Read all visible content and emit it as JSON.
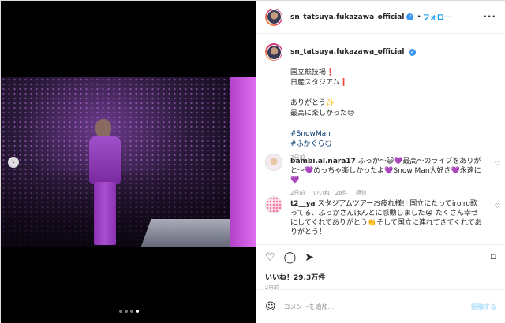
{
  "header": {
    "username": "sn_tatsuya.fukazawa_official",
    "separator": "•",
    "follow_label": "フォロー",
    "more_label": "···"
  },
  "media": {
    "prev_label": "‹",
    "dots": 4,
    "active_dot": 4
  },
  "caption": {
    "username": "sn_tatsuya.fukazawa_official",
    "lines": [
      "国立競技場❗",
      "日産スタジアム❗",
      "",
      "ありがとう✨",
      "最高に楽しかった😊",
      "",
      "#SnowMan",
      "#ふかぐらむ"
    ],
    "time": "2日前"
  },
  "comments": [
    {
      "username": "bambi.al.nara17",
      "text": "ふっか〜😺💜最高〜のライブをありがと〜💜めっちゃ楽しかったよ💜Snow Man大好き💜永遠に💜",
      "time": "2日前",
      "likes": "いいね！26件",
      "reply": "返信"
    },
    {
      "username": "t2__ya",
      "text": "スタジアムツアーお疲れ様!! 国立にたってiroiro歌ってる、ふっかさんほんとに感動しました😭 たくさん幸せにしてくれてありがとう👏そして国立に連れてきてくれてありがとう！",
      "time": "",
      "likes": "",
      "reply": ""
    }
  ],
  "actions": {
    "like_icon": "♡",
    "comment_icon": "◯",
    "share_icon": "➤",
    "bookmark_icon": "⌑",
    "likes_text": "いいね！29.3万件",
    "date": "2日前"
  },
  "add_comment": {
    "emoji": "☺",
    "placeholder": "コメントを追加...",
    "post_label": "投稿する"
  },
  "colors": {
    "accent": "#0095f6",
    "verified": "#3897f0",
    "stage_purple": "#b040c8"
  }
}
